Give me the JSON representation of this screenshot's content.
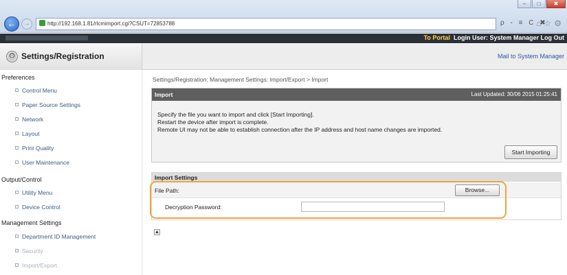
{
  "browser": {
    "url": "http://192.168.1.81/rlcmimport.cgi?CSUT=72853788",
    "url_host": "192.168.1.81",
    "addr_tools": "ρ - ≡ C ✖",
    "window_buttons": [
      "–",
      "□",
      "✖"
    ]
  },
  "topbar": {
    "portal": "To Portal",
    "login_user": "Login User: System Manager",
    "logout": "Log Out"
  },
  "header": {
    "title": "Settings/Registration",
    "mail_link": "Mail to System Manager"
  },
  "sidebar": {
    "preferences": "Preferences",
    "preferences_items": [
      "Control Menu",
      "Paper Source Settings",
      "Network",
      "Layout",
      "Print Quality",
      "User Maintenance"
    ],
    "output_control": "Output/Control",
    "output_items": [
      "Utility Menu",
      "Device Control"
    ],
    "management": "Management Settings",
    "management_items": [
      "Department ID Management",
      "Security",
      "Import/Export"
    ]
  },
  "main": {
    "breadcrumb": "Settings/Registration: Management Settings: Import/Export > Import",
    "import": {
      "title": "Import",
      "last_updated": "Last Updated: 30/06 2015 01:25:41",
      "line1": "Specify the file you want to import and click [Start Importing].",
      "line2": "Restart the device after import is complete.",
      "line3": "Remote UI may not be able to establish connection after the IP address and host name changes are imported.",
      "start_button": "Start Importing"
    },
    "settings": {
      "title": "Import Settings",
      "file_path_label": "File Path:",
      "browse_button": "Browse...",
      "password_label": "Decryption Password:"
    }
  }
}
